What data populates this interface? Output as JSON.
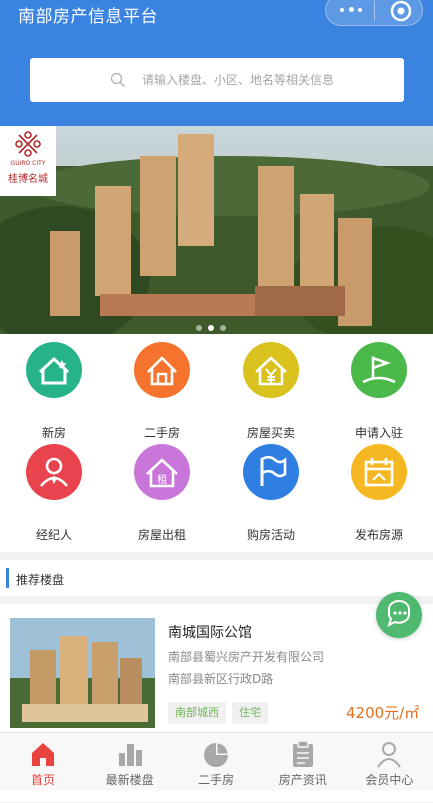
{
  "header": {
    "title": "南部房产信息平台",
    "background": "#3a83e0"
  },
  "capsule": {
    "more_icon": "more-dots-icon",
    "close_icon": "target-circle-icon"
  },
  "search": {
    "placeholder": "请输入楼盘、小区、地名等相关信息",
    "icon": "search-icon"
  },
  "banner": {
    "logo_text_top": "GUIRO CITY",
    "logo_text_main": "桂博名城",
    "slide_count": 3,
    "active_slide": 2
  },
  "menu": [
    {
      "label": "新房",
      "icon": "house-star-icon",
      "color": "#27b38a"
    },
    {
      "label": "二手房",
      "icon": "house-outline-icon",
      "color": "#f5732c"
    },
    {
      "label": "房屋买卖",
      "icon": "house-yen-icon",
      "color": "#d9c21e"
    },
    {
      "label": "申请入驻",
      "icon": "flag-ground-icon",
      "color": "#4bb84a"
    },
    {
      "label": "经纪人",
      "icon": "agent-person-icon",
      "color": "#e9434d"
    },
    {
      "label": "房屋出租",
      "icon": "house-rent-icon",
      "color": "#c876d9"
    },
    {
      "label": "购房活动",
      "icon": "flag-icon",
      "color": "#2f7ee2"
    },
    {
      "label": "发布房源",
      "icon": "calendar-house-icon",
      "color": "#f5b823"
    }
  ],
  "section": {
    "title": "推荐楼盘"
  },
  "listing": {
    "title": "南城国际公馆",
    "developer": "南部县蜀兴房产开发有限公司",
    "address": "南部县新区行政D路",
    "tags": [
      "南部城西",
      "住宅"
    ],
    "price": "4200元/㎡"
  },
  "fab": {
    "icon": "chat-bubble-icon"
  },
  "tabbar": [
    {
      "label": "首页",
      "icon": "home-icon",
      "active": true
    },
    {
      "label": "最新楼盘",
      "icon": "buildings-icon",
      "active": false
    },
    {
      "label": "二手房",
      "icon": "pie-chart-icon",
      "active": false
    },
    {
      "label": "房产资讯",
      "icon": "clipboard-icon",
      "active": false
    },
    {
      "label": "会员中心",
      "icon": "user-icon",
      "active": false
    }
  ]
}
